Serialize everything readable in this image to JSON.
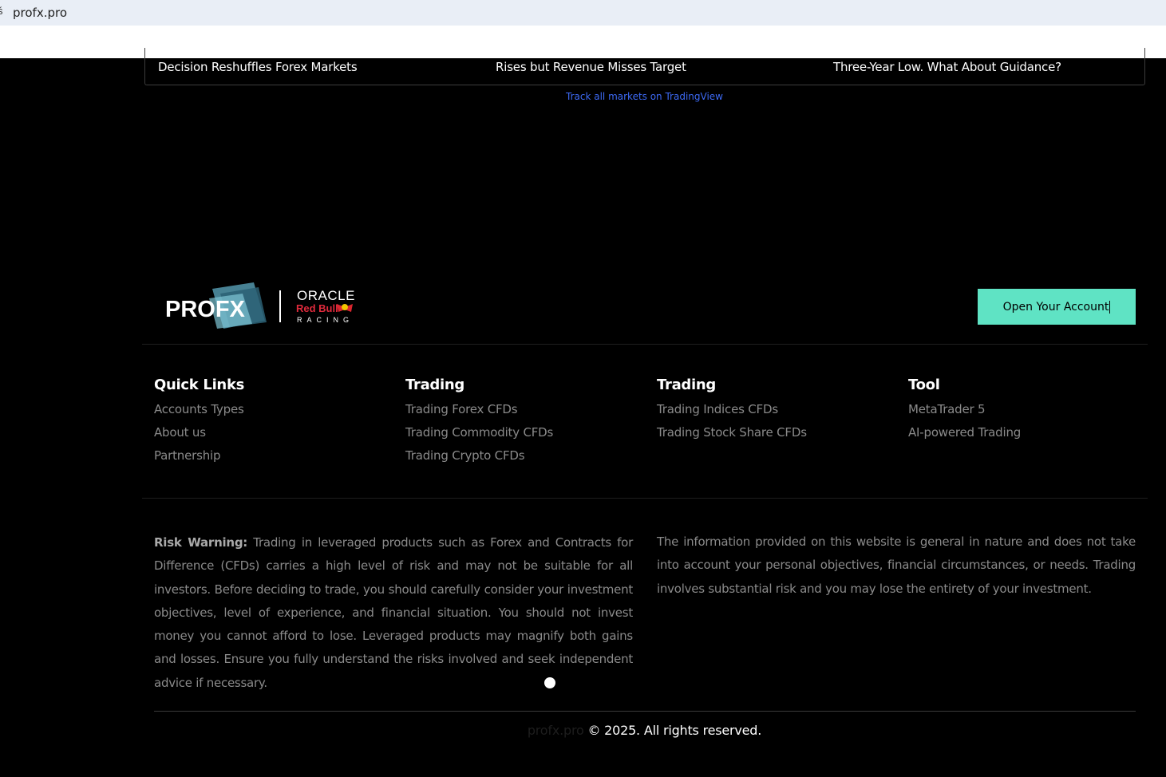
{
  "browser": {
    "url": "profx.pro"
  },
  "news": {
    "items": [
      "Decision Reshuffles Forex Markets",
      "Rises but Revenue Misses Target",
      "Three-Year Low. What About Guidance?"
    ],
    "track_link": "Track all markets on TradingView"
  },
  "logo": {
    "brand": "PROFX",
    "partner_line1": "ORACLE",
    "partner_line2": "Red Bull",
    "partner_line3": "RACING"
  },
  "cta_label": "Open Your Account",
  "columns": [
    {
      "heading": "Quick Links",
      "links": [
        "Accounts Types",
        "About us",
        "Partnership"
      ]
    },
    {
      "heading": "Trading",
      "links": [
        "Trading Forex CFDs",
        "Trading Commodity CFDs",
        "Trading Crypto CFDs"
      ]
    },
    {
      "heading": "Trading",
      "links": [
        "Trading Indices CFDs",
        "Trading Stock Share CFDs"
      ]
    },
    {
      "heading": "Tool",
      "links": [
        "MetaTrader 5",
        "AI-powered Trading"
      ]
    }
  ],
  "risk": {
    "label": "Risk Warning:",
    "text": " Trading in leveraged products such as Forex and Contracts for Difference (CFDs) carries a high level of risk and may not be suitable for all investors. Before deciding to trade, you should carefully consider your investment objectives, level of experience, and financial situation. You should not invest money you cannot afford to lose. Leveraged products may magnify both gains and losses. Ensure you fully understand the risks involved and seek independent advice if necessary."
  },
  "info_text": "The information provided on this website is general in nature and does not take into account your personal objectives, financial circumstances, or needs. Trading involves substantial risk and you may lose the entirety of your investment.",
  "footer": {
    "site": "profx.pro",
    "copyright": " © 2025. All rights reserved."
  },
  "colors": {
    "accent": "#5fe3c4",
    "link_blue": "#3d6af5",
    "muted_text": "#8a8a8a"
  }
}
